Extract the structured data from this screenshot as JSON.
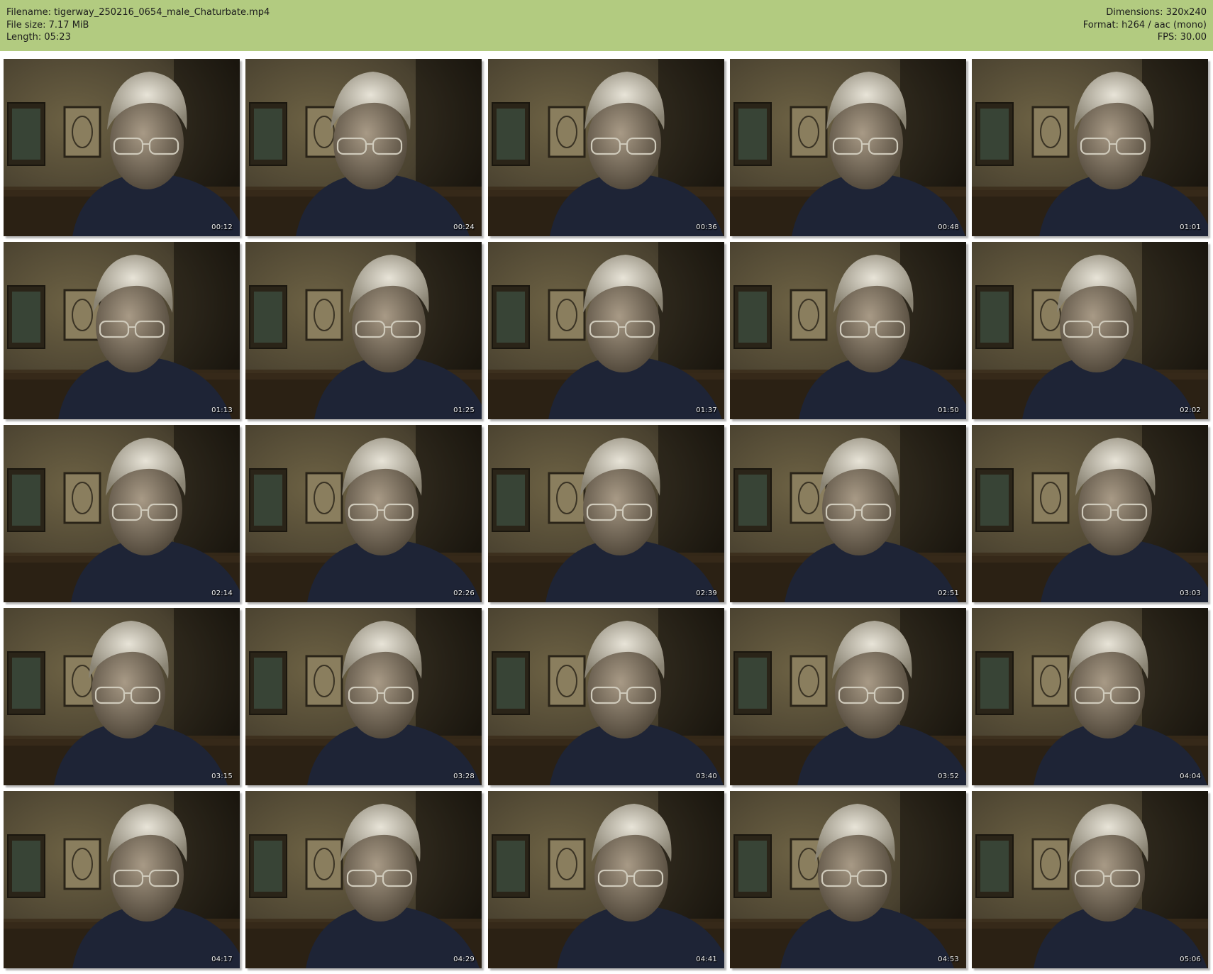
{
  "info": {
    "filename_label": "Filename:",
    "filename": "tigerway_250216_0654_male_Chaturbate.mp4",
    "filesize_label": "File size:",
    "filesize": "7.17 MiB",
    "length_label": "Length:",
    "length": "05:23",
    "dimensions_label": "Dimensions:",
    "dimensions": "320x240",
    "format_label": "Format:",
    "format": "h264 / aac (mono)",
    "fps_label": "FPS:",
    "fps": "30.00"
  },
  "colors": {
    "header_bg": "#b2cb80",
    "wall": "#5a5036",
    "shirt": "#1e2436"
  },
  "thumbnails": [
    {
      "timestamp": "00:12"
    },
    {
      "timestamp": "00:24"
    },
    {
      "timestamp": "00:36"
    },
    {
      "timestamp": "00:48"
    },
    {
      "timestamp": "01:01"
    },
    {
      "timestamp": "01:13"
    },
    {
      "timestamp": "01:25"
    },
    {
      "timestamp": "01:37"
    },
    {
      "timestamp": "01:50"
    },
    {
      "timestamp": "02:02"
    },
    {
      "timestamp": "02:14"
    },
    {
      "timestamp": "02:26"
    },
    {
      "timestamp": "02:39"
    },
    {
      "timestamp": "02:51"
    },
    {
      "timestamp": "03:03"
    },
    {
      "timestamp": "03:15"
    },
    {
      "timestamp": "03:28"
    },
    {
      "timestamp": "03:40"
    },
    {
      "timestamp": "03:52"
    },
    {
      "timestamp": "04:04"
    },
    {
      "timestamp": "04:17"
    },
    {
      "timestamp": "04:29"
    },
    {
      "timestamp": "04:41"
    },
    {
      "timestamp": "04:53"
    },
    {
      "timestamp": "05:06"
    }
  ]
}
